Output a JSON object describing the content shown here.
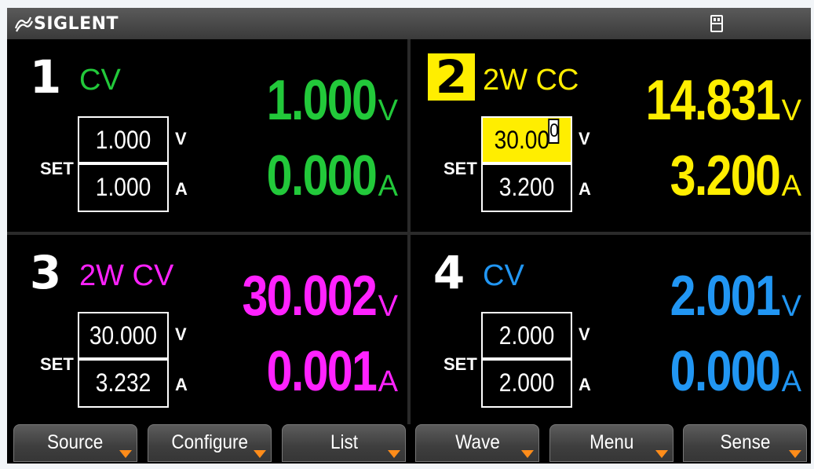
{
  "brand": {
    "name": "SIGLENT"
  },
  "colors": {
    "ch1": "#22c93a",
    "ch2": "#ffee00",
    "ch3": "#ff22ff",
    "ch4": "#2196f3",
    "softkey_marker": "#ff8c1a"
  },
  "channels": [
    {
      "number": "1",
      "mode": "CV",
      "voltage": "1.000",
      "current": "0.000",
      "set_voltage": "1.000",
      "set_current": "1.000",
      "unit_v": "V",
      "unit_a": "A",
      "set_label": "SET",
      "selected": false
    },
    {
      "number": "2",
      "mode": "2W CC",
      "voltage": "14.831",
      "current": "3.200",
      "set_voltage": "30.00",
      "set_voltage_cursor": "0",
      "set_current": "3.200",
      "unit_v": "V",
      "unit_a": "A",
      "set_label": "SET",
      "selected": true
    },
    {
      "number": "3",
      "mode": "2W CV",
      "voltage": "30.002",
      "current": "0.001",
      "set_voltage": "30.000",
      "set_current": "3.232",
      "unit_v": "V",
      "unit_a": "A",
      "set_label": "SET",
      "selected": false
    },
    {
      "number": "4",
      "mode": "CV",
      "voltage": "2.001",
      "current": "0.000",
      "set_voltage": "2.000",
      "set_current": "2.000",
      "unit_v": "V",
      "unit_a": "A",
      "set_label": "SET",
      "selected": false
    }
  ],
  "softkeys": [
    {
      "label": "Source"
    },
    {
      "label": "Configure"
    },
    {
      "label": "List"
    },
    {
      "label": "Wave"
    },
    {
      "label": "Menu"
    },
    {
      "label": "Sense"
    }
  ],
  "status": {
    "usb_icon": "usb-storage-icon"
  }
}
